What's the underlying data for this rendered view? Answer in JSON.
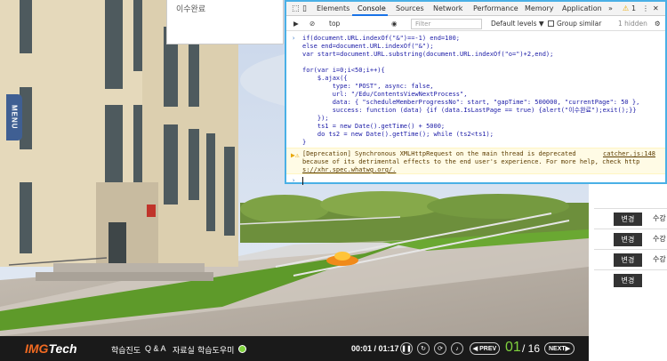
{
  "popup": {
    "text": "이수완료"
  },
  "menu_tab": {
    "label": "MENU"
  },
  "player": {
    "logo_brand": "IMG",
    "logo_suffix": "Tech",
    "nav": [
      "학습진도",
      "Q & A",
      "자료실",
      "학습도우미"
    ],
    "time": "00:01 / 01:17",
    "prev_label": "◀ PREV",
    "next_label": "NEXT▶",
    "page_current": "01",
    "page_total": "/ 16",
    "accent": "#7fd23e"
  },
  "right_table": {
    "button_label": "변경",
    "rows": [
      "수강",
      "수강",
      "수강",
      ""
    ]
  },
  "devtools": {
    "tabs": [
      "Elements",
      "Console",
      "Sources",
      "Network",
      "Performance",
      "Memory",
      "Application",
      "»"
    ],
    "warning_count": "1",
    "context": "top",
    "filter_placeholder": "Filter",
    "levels": "Default levels ▼",
    "group_similar": "Group similar",
    "hidden": "1 hidden",
    "code_lines": [
      "if(document.URL.indexOf(\"&\")==-1) end=100;",
      "else end=document.URL.indexOf(\"&\");",
      "var start=document.URL.substring(document.URL.indexOf(\"o=\")+2,end);",
      "",
      "for(var i=0;i<50;i++){",
      "    $.ajax({",
      "        type: \"POST\", async: false,",
      "        url: \"/Edu/ContentsViewNextProcess\",",
      "        data: { \"scheduleMemberProgressNo\": start, \"gapTime\": 500000, \"currentPage\": 50 },",
      "        success: function (data) {if (data.IsLastPage == true) {alert(\"이수완료\");exit();}}",
      "    });",
      "    ts1 = new Date().getTime() + 5000;",
      "    do ts2 = new Date().getTime(); while (ts2<ts1);",
      "}"
    ],
    "warning_lines": [
      "[Deprecation] Synchronous XMLHttpRequest on the main thread is deprecated",
      "because of its detrimental effects to the end user's experience. For more help, check http",
      "s://xhr.spec.whatwg.org/."
    ],
    "warning_source": "catcher.js:148"
  }
}
